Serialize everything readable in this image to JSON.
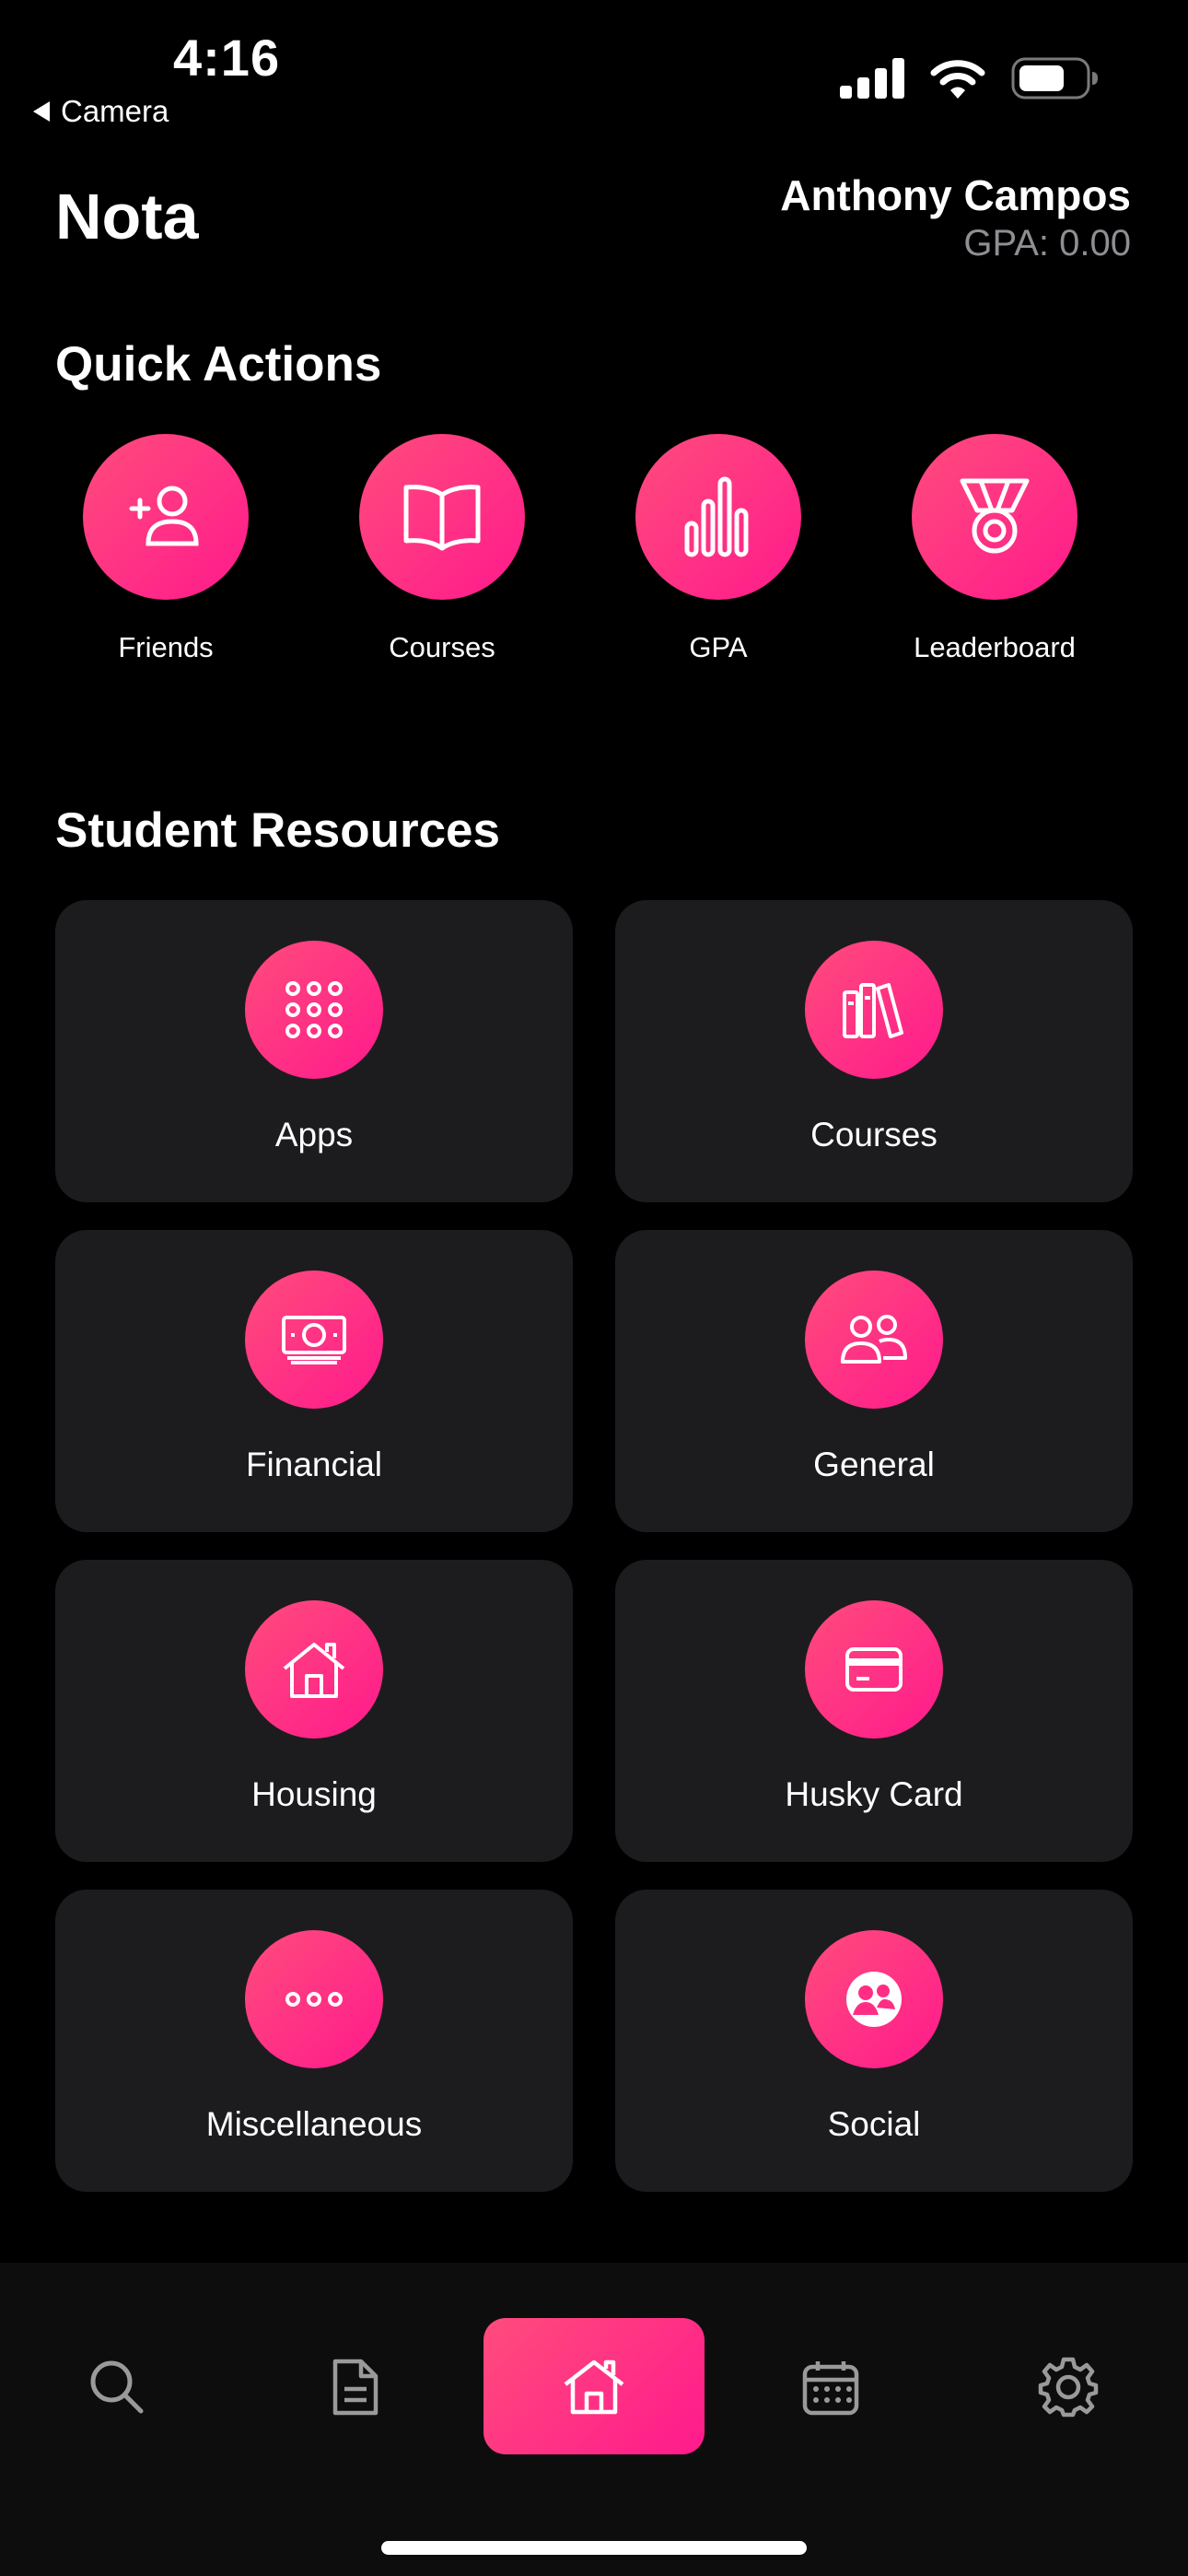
{
  "status_bar": {
    "time": "4:16",
    "back_label": "Camera"
  },
  "header": {
    "app_title": "Nota",
    "user_name": "Anthony Campos",
    "gpa": "GPA: 0.00"
  },
  "quick_actions": {
    "title": "Quick Actions",
    "items": [
      {
        "label": "Friends",
        "icon": "add-person-icon"
      },
      {
        "label": "Courses",
        "icon": "open-book-icon"
      },
      {
        "label": "GPA",
        "icon": "bar-chart-icon"
      },
      {
        "label": "Leaderboard",
        "icon": "medal-icon"
      }
    ]
  },
  "student_resources": {
    "title": "Student Resources",
    "items": [
      {
        "label": "Apps",
        "icon": "grid-icon"
      },
      {
        "label": "Courses",
        "icon": "books-icon"
      },
      {
        "label": "Financial",
        "icon": "banknote-icon"
      },
      {
        "label": "General",
        "icon": "people-icon"
      },
      {
        "label": "Housing",
        "icon": "house-icon"
      },
      {
        "label": "Husky Card",
        "icon": "card-icon"
      },
      {
        "label": "Miscellaneous",
        "icon": "more-icon"
      },
      {
        "label": "Social",
        "icon": "social-icon"
      }
    ]
  },
  "tab_bar": {
    "tabs": [
      "search-icon",
      "document-icon",
      "home-icon",
      "calendar-icon",
      "gear-icon"
    ],
    "active": "home-icon"
  },
  "colors": {
    "accent_start": "#ff4c7c",
    "accent_end": "#ff1a8c",
    "card_bg": "#1c1c1e",
    "secondary_text": "#8e8e93"
  }
}
